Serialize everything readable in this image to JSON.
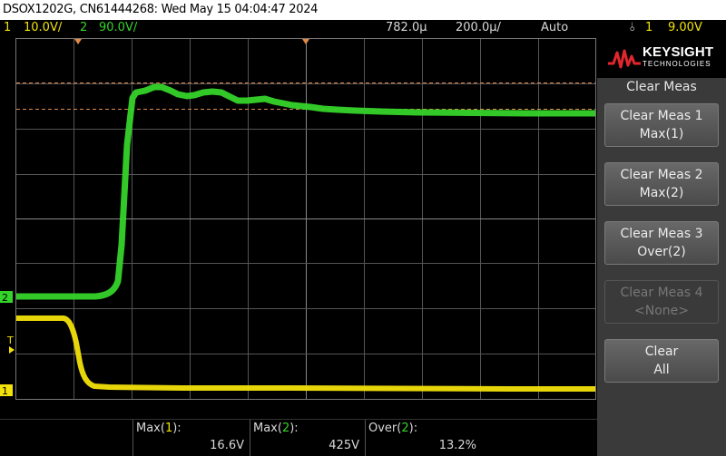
{
  "title_bar": {
    "text": "DSOX1202G, CN61444268: Wed May 15 04:04:47 2024"
  },
  "status": {
    "ch1_num": "1",
    "ch1_scale": "10.0V/",
    "ch2_num": "2",
    "ch2_scale": "90.0V/",
    "time_pos": "782.0µ",
    "time_scale": "200.0µ/",
    "trig_mode": "Auto",
    "trig_level": "9.00V",
    "trig_channel": "1"
  },
  "markers": {
    "ch2_marker": "2",
    "ch1_marker": "1",
    "trigger_marker": "T"
  },
  "measurements": [
    {
      "name": "Max(",
      "src": "1",
      "suffix": "):",
      "value": "16.6V"
    },
    {
      "name": "Max(",
      "src": "2",
      "suffix": "):",
      "value": "425V"
    },
    {
      "name": "Over(",
      "src": "2",
      "suffix": "):",
      "value": "13.2%"
    }
  ],
  "softkey_menu": {
    "logo": "KEYSIGHT",
    "logo_sub": "TECHNOLOGIES",
    "title": "Clear Meas",
    "keys": [
      {
        "line1": "Clear Meas 1",
        "line2": "Max(1)"
      },
      {
        "line1": "Clear Meas 2",
        "line2": "Max(2)"
      },
      {
        "line1": "Clear Meas 3",
        "line2": "Over(2)"
      },
      {
        "line1": "Clear Meas 4",
        "line2": "<None>"
      },
      {
        "line1": "Clear",
        "line2": "All"
      }
    ]
  },
  "colors": {
    "ch1": "#f2e20a",
    "ch2": "#35d42a",
    "cursor": "#e08a4a",
    "grid": "#555555"
  }
}
